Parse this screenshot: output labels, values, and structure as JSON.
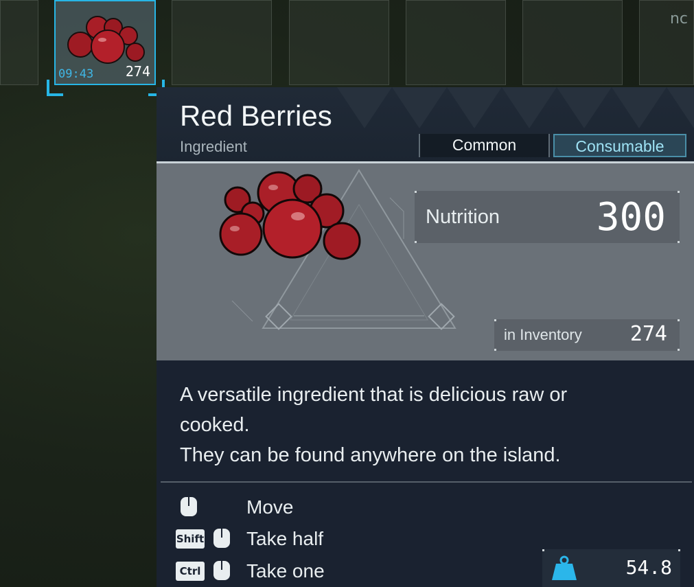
{
  "inventory": {
    "selected_slot": {
      "timer": "09:43",
      "count": "274",
      "icon": "red-berries-icon"
    },
    "partial_text": "nc"
  },
  "tooltip": {
    "title": "Red Berries",
    "category": "Ingredient",
    "tags": {
      "rarity": "Common",
      "type": "Consumable"
    },
    "stats": {
      "nutrition_label": "Nutrition",
      "nutrition_value": "300",
      "inventory_label": "in Inventory",
      "inventory_value": "274"
    },
    "description": [
      "A versatile ingredient that is delicious raw or",
      "cooked.",
      "They can be found anywhere on the island."
    ],
    "controls": [
      {
        "keys": [],
        "icon": "mouse-left-icon",
        "label": "Move"
      },
      {
        "keys": [
          "Shift"
        ],
        "icon": "mouse-left-icon",
        "label": "Take half"
      },
      {
        "keys": [
          "Ctrl"
        ],
        "icon": "mouse-left-icon",
        "label": "Take one"
      }
    ],
    "weight": {
      "icon": "weight-icon",
      "value": "54.8"
    }
  },
  "colors": {
    "accent_blue": "#27b6e6",
    "consumable_text": "#9fe3f5",
    "panel_bg": "#1a2230",
    "berry_red": "#b3202a"
  }
}
